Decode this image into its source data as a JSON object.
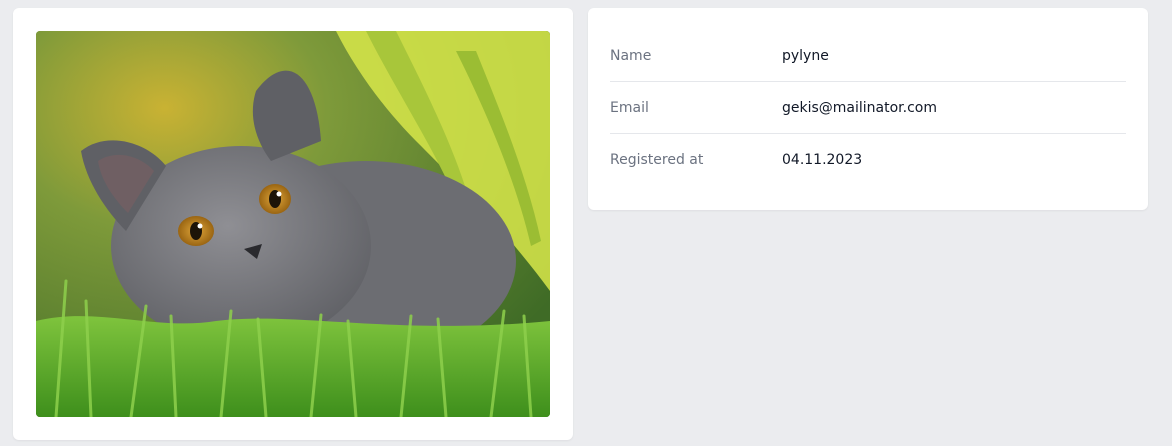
{
  "profile": {
    "photo_alt": "Kitten",
    "fields": [
      {
        "label": "Name",
        "value": "pylyne"
      },
      {
        "label": "Email",
        "value": "gekis@mailinator.com"
      },
      {
        "label": "Registered at",
        "value": "04.11.2023"
      }
    ]
  },
  "colors": {
    "page_bg": "#ebecef",
    "card_bg": "#ffffff",
    "label_text": "#6b7280",
    "value_text": "#111827",
    "divider": "#e5e7eb"
  }
}
